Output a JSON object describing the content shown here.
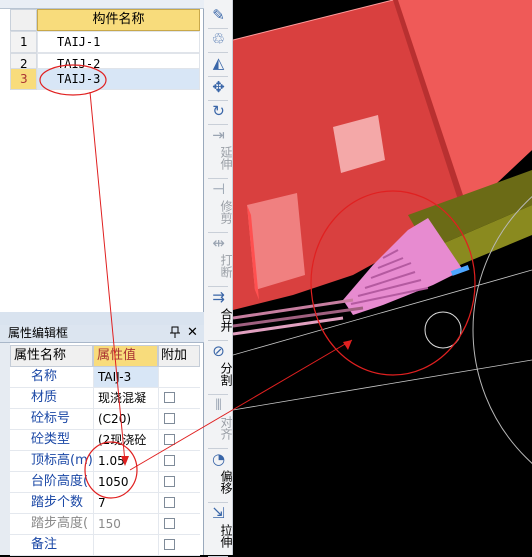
{
  "component_list": {
    "header": "构件名称",
    "rows": [
      {
        "index": "1",
        "name": "TAIJ-1",
        "selected": false
      },
      {
        "index": "2",
        "name": "TAIJ-2",
        "selected": false
      },
      {
        "index": "3",
        "name": "TAIJ-3",
        "selected": true
      }
    ]
  },
  "property_editor": {
    "title": "属性编辑框",
    "pin_glyph": "ꟷ",
    "close_glyph": "✕",
    "headers": {
      "name": "属性名称",
      "value": "属性值",
      "extra": "附加"
    },
    "rows": [
      {
        "name": "名称",
        "value": "TAIJ-3",
        "checkbox": false,
        "gray": false
      },
      {
        "name": "材质",
        "value": "现浇混凝",
        "checkbox": true,
        "gray": false
      },
      {
        "name": "砼标号",
        "value": "(C20)",
        "checkbox": true,
        "gray": false
      },
      {
        "name": "砼类型",
        "value": "(2现浇砼",
        "checkbox": true,
        "gray": false
      },
      {
        "name": "顶标高(m)",
        "value": "1.05",
        "checkbox": true,
        "gray": false
      },
      {
        "name": "台阶高度(",
        "value": "1050",
        "checkbox": true,
        "gray": false
      },
      {
        "name": "踏步个数",
        "value": "7",
        "checkbox": true,
        "gray": false
      },
      {
        "name": "踏步高度(",
        "value": "150",
        "checkbox": true,
        "gray": true
      },
      {
        "name": "备注",
        "value": "",
        "checkbox": true,
        "gray": false
      }
    ]
  },
  "toolbar": {
    "items": [
      {
        "icon": "brush-icon",
        "glyph": "✎",
        "label": "",
        "disabled": false
      },
      {
        "icon": "paint-icon",
        "glyph": "♲",
        "label": "",
        "disabled": false
      },
      {
        "icon": "mirror-icon",
        "glyph": "◭",
        "label": "",
        "disabled": false
      },
      {
        "icon": "move-icon",
        "glyph": "✥",
        "label": "",
        "disabled": false
      },
      {
        "icon": "rotate-icon",
        "glyph": "↻",
        "label": "",
        "disabled": false
      },
      {
        "icon": "extend-icon",
        "glyph": "⇥",
        "label": "延伸",
        "disabled": true
      },
      {
        "icon": "trim-icon",
        "glyph": "⊣",
        "label": "修剪",
        "disabled": true
      },
      {
        "icon": "break-icon",
        "glyph": "⇹",
        "label": "打断",
        "disabled": true
      },
      {
        "icon": "merge-icon",
        "glyph": "⇉",
        "label": "合并",
        "disabled": false
      },
      {
        "icon": "split-icon",
        "glyph": "⊘",
        "label": "分割",
        "disabled": false
      },
      {
        "icon": "align-icon",
        "glyph": "⫴",
        "label": "对齐",
        "disabled": true
      },
      {
        "icon": "offset-icon",
        "glyph": "◔",
        "label": "偏移",
        "disabled": false
      },
      {
        "icon": "stretch-icon",
        "glyph": "⇲",
        "label": "拉伸",
        "disabled": false
      }
    ]
  },
  "colors": {
    "selection_row": "#d8e6f6",
    "header_yellow": "#f8dc7c",
    "annotation_red": "#e02020",
    "slab_red": "#d9403f",
    "stair_pink": "#e78bd0",
    "beam_olive": "#6b6b16"
  }
}
